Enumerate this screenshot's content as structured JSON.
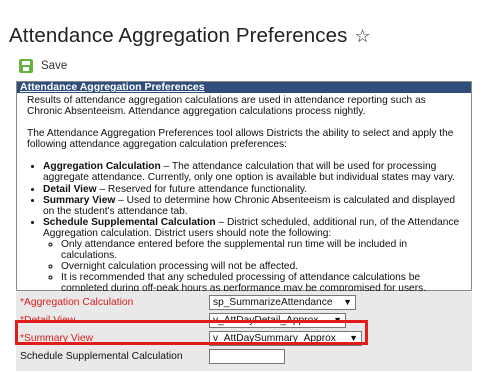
{
  "header": {
    "title": "Attendance Aggregation Preferences",
    "favorite_icon": "star-outline-icon"
  },
  "toolbar": {
    "save_label": "Save",
    "save_icon": "save-icon",
    "save_color": "#67b33f"
  },
  "panel": {
    "header": "Attendance Aggregation Preferences",
    "header_color": "#2f4f7a",
    "para1": "Results of attendance aggregation calculations are used in attendance reporting such as Chronic Absenteeism. Attendance aggregation calculations process nightly.",
    "para2": "The Attendance Aggregation Preferences tool allows Districts the ability to select and apply the following attendance aggregation calculation preferences:",
    "items": [
      {
        "term": "Aggregation Calculation",
        "text": " – The attendance calculation that will be used for processing aggregate attendance. Currently, only one option is available but individual states may vary."
      },
      {
        "term": "Detail View",
        "text": " – Reserved for future attendance functionality."
      },
      {
        "term": "Summary View",
        "text": " – Used to determine how Chronic Absenteeism is calculated and displayed on the student's attendance tab."
      },
      {
        "term": "Schedule Supplemental Calculation",
        "text": " – District scheduled, additional run, of the Attendance Aggregation calculation. District users should note the following:"
      }
    ],
    "subitems": [
      "Only attendance entered before the supplemental run time will be included in calculations.",
      "Overnight calculation processing will not be affected.",
      "It is recommended that any scheduled processing of attendance calculations be completed during off-peak hours as performance may be compromised for users."
    ]
  },
  "form": {
    "aggregation_label": "*Aggregation Calculation",
    "aggregation_value": "sp_SummarizeAttendance",
    "detail_label": "*Detail View",
    "detail_value": "v_AttDayDetail_Approx",
    "summary_label": "*Summary View",
    "summary_value": "v_AttDaySummary_Approx",
    "schedule_label": "Schedule Supplemental Calculation",
    "schedule_value": "",
    "required_color": "#d62020",
    "highlight_color": "#e21b1b"
  }
}
